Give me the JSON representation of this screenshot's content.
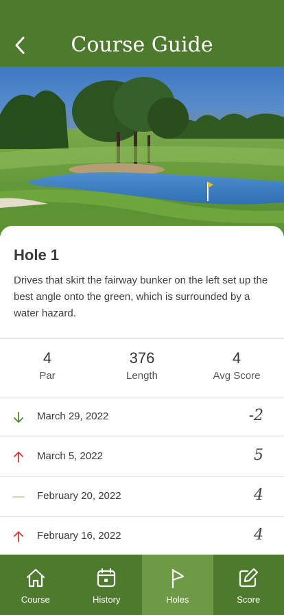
{
  "header": {
    "title": "Course Guide",
    "back_icon": "chevron-left-icon"
  },
  "hero": {
    "alt": "Golf course with water hazard and trees"
  },
  "hole": {
    "title": "Hole 1",
    "description": "Drives that skirt the fairway bunker on the left set up the best angle onto the green, which is surrounded by a water hazard."
  },
  "stats": [
    {
      "value": "4",
      "label": "Par"
    },
    {
      "value": "376",
      "label": "Length"
    },
    {
      "value": "4",
      "label": "Avg Score"
    }
  ],
  "history": [
    {
      "date": "March 29, 2022",
      "score": "-2",
      "trend": "down",
      "icon": "arrow-down-icon",
      "color": "#4e8a2e"
    },
    {
      "date": "March 5, 2022",
      "score": "5",
      "trend": "up",
      "icon": "arrow-up-icon",
      "color": "#e0332f"
    },
    {
      "date": "February 20, 2022",
      "score": "4",
      "trend": "even",
      "icon": "dash-icon",
      "color": "#c9d3a6"
    },
    {
      "date": "February 16, 2022",
      "score": "4",
      "trend": "up",
      "icon": "arrow-up-icon",
      "color": "#e0332f"
    }
  ],
  "tabs": [
    {
      "label": "Course",
      "icon": "home-icon",
      "active": false
    },
    {
      "label": "History",
      "icon": "calendar-icon",
      "active": false
    },
    {
      "label": "Holes",
      "icon": "flag-icon",
      "active": true
    },
    {
      "label": "Score",
      "icon": "edit-icon",
      "active": false
    }
  ],
  "colors": {
    "header": "#4e7a2e",
    "tab_active": "#6e9a45"
  }
}
